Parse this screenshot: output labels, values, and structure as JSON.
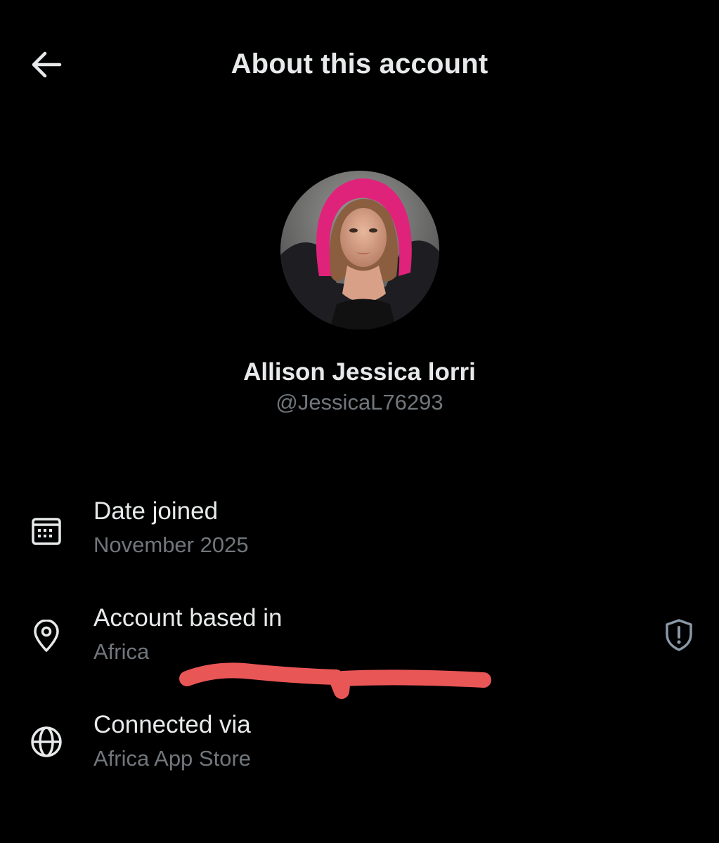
{
  "header": {
    "back_icon": "arrow-left-icon",
    "title": "About this account"
  },
  "profile": {
    "avatar": "profile-photo",
    "display_name": "Allison Jessica lorri",
    "handle": "@JessicaL76293"
  },
  "details": [
    {
      "icon": "calendar-icon",
      "label": "Date joined",
      "value": "November 2025"
    },
    {
      "icon": "location-pin-icon",
      "label": "Account based in",
      "value": "Africa",
      "badge_icon": "shield-alert-icon"
    },
    {
      "icon": "globe-icon",
      "label": "Connected via",
      "value": "Africa App Store"
    }
  ],
  "colors": {
    "background": "#000000",
    "primary_text": "#e7e9ea",
    "secondary_text": "#71767b",
    "annotation": "#e95656"
  }
}
